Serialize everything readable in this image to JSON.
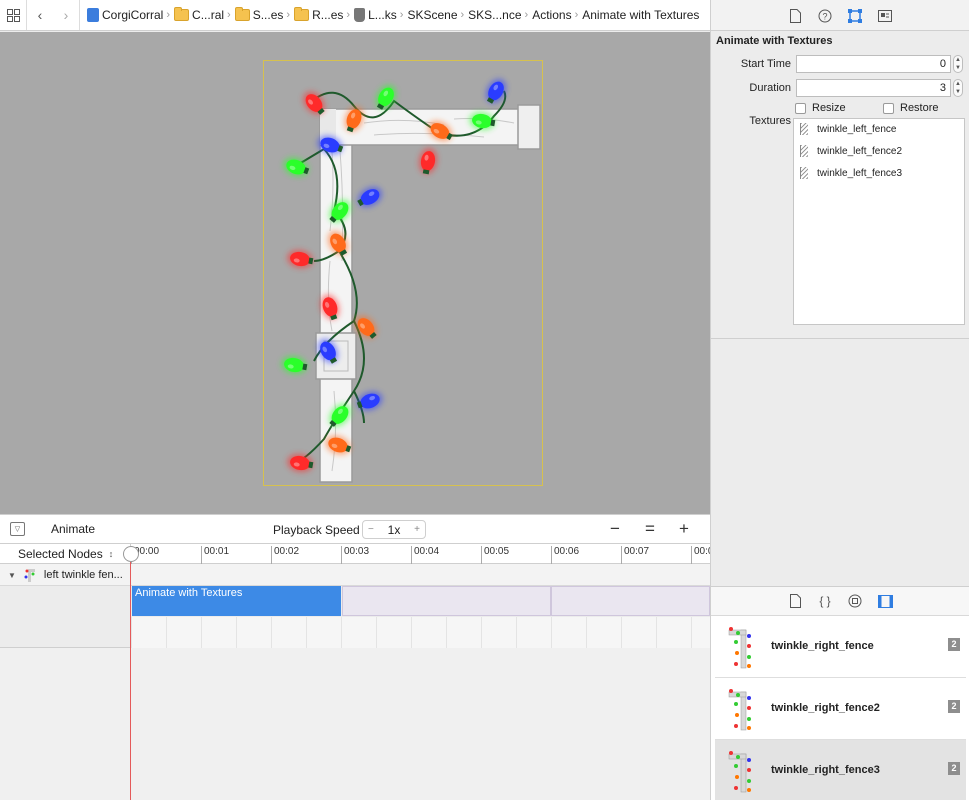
{
  "jumpbar": {
    "crumbs": [
      {
        "label": "CorgiCorral",
        "icon": "project-icon"
      },
      {
        "label": "C...ral",
        "icon": "folder-icon"
      },
      {
        "label": "S...es",
        "icon": "folder-icon"
      },
      {
        "label": "R...es",
        "icon": "folder-icon"
      },
      {
        "label": "L...ks",
        "icon": "file-icon"
      },
      {
        "label": "SKScene",
        "icon": "none"
      },
      {
        "label": "SKS...nce",
        "icon": "none"
      },
      {
        "label": "Actions",
        "icon": "none"
      },
      {
        "label": "Animate with Textures",
        "icon": "none"
      }
    ]
  },
  "timeline": {
    "title": "Animate",
    "speed_label": "Playback Speed",
    "speed_value": "1x",
    "speed_minus": "−",
    "speed_plus": "+",
    "zoom_out": "−",
    "zoom_fit": "=",
    "zoom_in": "+",
    "selector_label": "Selected Nodes",
    "ticks": [
      "00:00",
      "00:01",
      "00:02",
      "00:03",
      "00:04",
      "00:05",
      "00:06",
      "00:07",
      "00:0"
    ],
    "node_label": "left twinkle fen...",
    "action_label": "Animate with Textures"
  },
  "inspector": {
    "title": "Animate with Textures",
    "start_time_label": "Start Time",
    "start_time_value": "0",
    "duration_label": "Duration",
    "duration_value": "3",
    "resize_label": "Resize",
    "restore_label": "Restore",
    "textures_label": "Textures",
    "textures": [
      "twinkle_left_fence",
      "twinkle_left_fence2",
      "twinkle_left_fence3"
    ]
  },
  "library": {
    "items": [
      {
        "name": "twinkle_right_fence",
        "badge": "2",
        "selected": false
      },
      {
        "name": "twinkle_right_fence2",
        "badge": "2",
        "selected": false
      },
      {
        "name": "twinkle_right_fence3",
        "badge": "2",
        "selected": true
      }
    ]
  },
  "colors": {
    "canvas_bg": "#a8a8a8",
    "selection_frame": "#d6c14e",
    "action_block": "#3d8ae6",
    "playhead": "#e45a5a",
    "bulb_red": "#ff2a2a",
    "bulb_green": "#2aff2a",
    "bulb_blue": "#2a3cff",
    "bulb_orange": "#ff6a1a"
  }
}
